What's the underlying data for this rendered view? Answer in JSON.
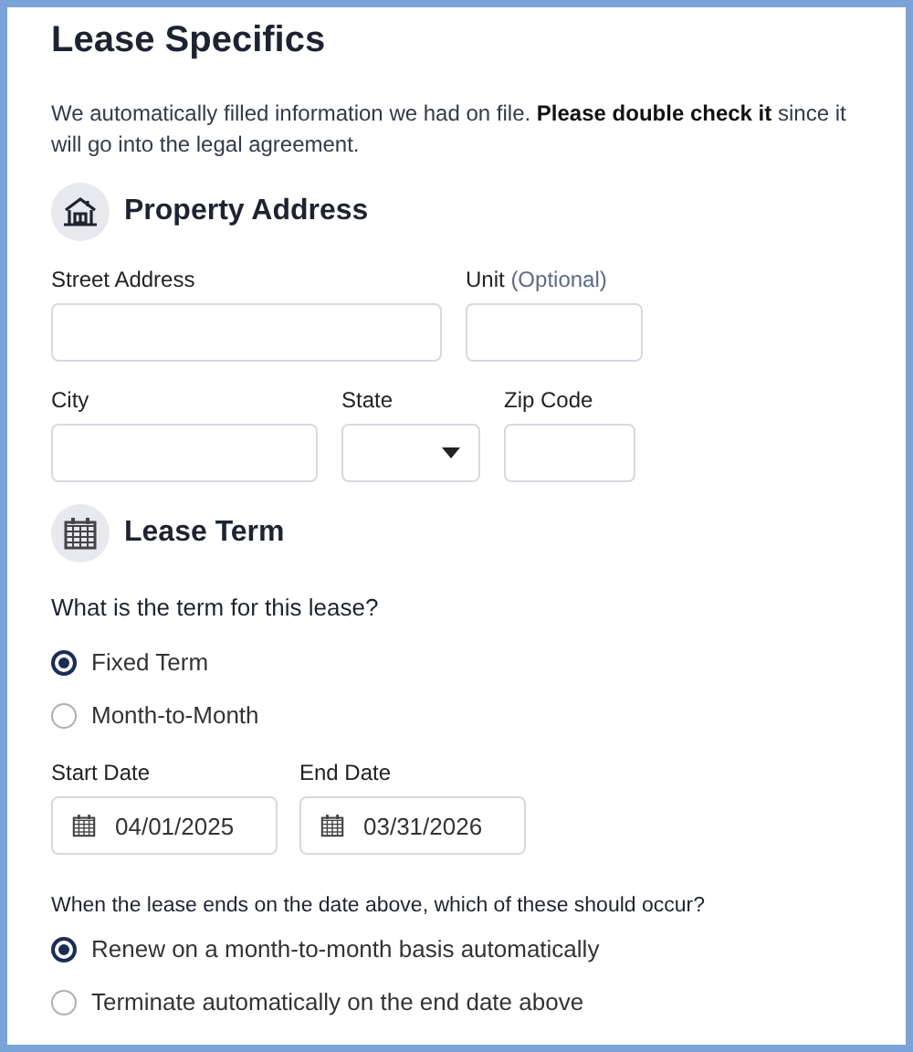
{
  "title": "Lease Specifics",
  "intro": "We automatically filled information we had on file. **Please double check it** since it will go into the legal agreement.",
  "sections": [
    {
      "kind": "address",
      "heading": "Property Address",
      "fields": [
        {
          "label": "Street Address",
          "kind": "text"
        },
        {
          "label": "Unit",
          "optional": "(Optional)",
          "kind": "text"
        },
        {
          "label": "City",
          "kind": "text"
        },
        {
          "label": "State",
          "kind": "select"
        },
        {
          "label": "Zip Code",
          "kind": "text"
        }
      ]
    },
    {
      "kind": "term",
      "heading": "Lease Term"
    }
  ],
  "term_question": "What is the term for this lease?",
  "term_options": [
    {
      "label": "Fixed Term",
      "selected": true
    },
    {
      "label": "Month-to-Month",
      "selected": false
    }
  ],
  "dates": [
    {
      "label": "Start Date",
      "value": "04/01/2025"
    },
    {
      "label": "End Date",
      "value": "03/31/2026"
    }
  ],
  "end_question": "When the lease ends on the date above, which of these should occur?",
  "end_options": [
    {
      "label": "Renew on a month-to-month basis automatically",
      "selected": true
    },
    {
      "label": "Terminate automatically on the end date above",
      "selected": false
    }
  ]
}
